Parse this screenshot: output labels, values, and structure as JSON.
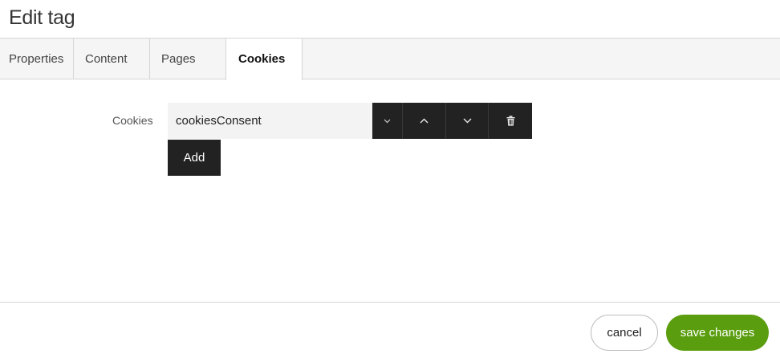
{
  "dialog": {
    "title": "Edit tag"
  },
  "tabs": [
    {
      "label": "Properties",
      "active": false
    },
    {
      "label": "Content",
      "active": false
    },
    {
      "label": "Pages",
      "active": false
    },
    {
      "label": "Cookies",
      "active": true
    }
  ],
  "cookies_field": {
    "label": "Cookies",
    "value": "cookiesConsent",
    "controls": [
      "dropdown-chevron-icon",
      "move-up-icon",
      "move-down-icon",
      "trash-icon"
    ],
    "add_label": "Add"
  },
  "footer": {
    "cancel_label": "cancel",
    "save_label": "save changes"
  },
  "colors": {
    "accent": "#5a9e0f",
    "dark_button": "#222222",
    "tab_bar": "#f5f5f5"
  }
}
